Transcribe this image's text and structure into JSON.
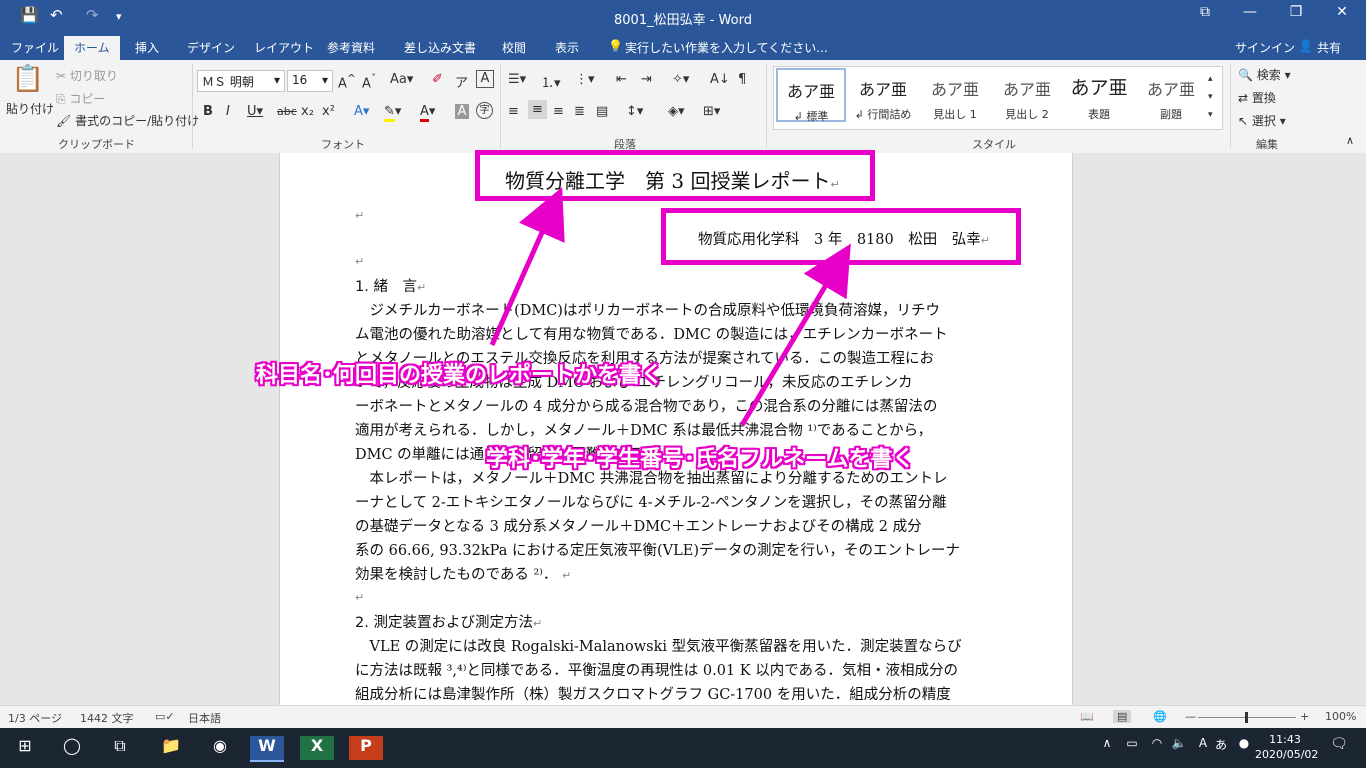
{
  "app": {
    "title": "8001_松田弘幸 - Word",
    "qat": {
      "save_glyph": "💾",
      "undo_glyph": "↶",
      "redo_glyph": "↷",
      "customize_glyph": "▾"
    },
    "window": {
      "restore_ribbon": "⧉",
      "minimize": "—",
      "maximize": "❐",
      "close": "✕"
    }
  },
  "tabs": [
    "ファイル",
    "ホーム",
    "挿入",
    "デザイン",
    "レイアウト",
    "参考資料",
    "差し込み文書",
    "校閲",
    "表示"
  ],
  "active_tab": "ホーム",
  "tell_me": "実行したい作業を入力してください...",
  "signin": "サインイン",
  "share": "共有",
  "ribbon": {
    "clipboard": {
      "paste": "貼り付け",
      "cut": "切り取り",
      "copy": "コピー",
      "format_painter": "書式のコピー/貼り付け",
      "label": "クリップボード"
    },
    "font": {
      "name": "ＭＳ 明朝",
      "size": "16",
      "label": "フォント"
    },
    "paragraph": {
      "label": "段落"
    },
    "styles": {
      "items": [
        {
          "sample": "あア亜",
          "name": "↲ 標準"
        },
        {
          "sample": "あア亜",
          "name": "↲ 行間詰め"
        },
        {
          "sample": "あア亜",
          "name": "見出し 1"
        },
        {
          "sample": "あア亜",
          "name": "見出し 2"
        },
        {
          "sample": "あア亜",
          "name": "表題"
        },
        {
          "sample": "あア亜",
          "name": "副題"
        }
      ],
      "label": "スタイル"
    },
    "editing": {
      "find": "検索",
      "replace": "置換",
      "select": "選択",
      "label": "編集"
    }
  },
  "document": {
    "title": "物質分離工学　第 3 回授業レポート",
    "author_line": "物質応用化学科　3 年　8180　松田　弘幸",
    "heading1": "1. 緒　言",
    "para1": [
      "　ジメチルカーボネート(DMC)はポリカーボネートの合成原料や低環境負荷溶媒，リチウ",
      "ム電池の優れた助溶媒として有用な物質である．DMC の製造には，エチレンカーボネート",
      "とメタノールとのエステル交換反応を利用する方法が提案されている．この製造工程にお",
      "いて，反応後の生成物は主成 DMC および エチレングリコール，未反応のエチレンカ",
      "ーボネートとメタノールの 4 成分から成る混合物であり，この混合系の分離には蒸留法の",
      "適用が考えられる．しかし，メタノール＋DMC 系は最低共沸混合物 ¹⁾であることから，",
      "DMC の単離には通常の蒸留では困難である．"
    ],
    "para2": [
      "　本レポートは，メタノール＋DMC 共沸混合物を抽出蒸留により分離するためのエントレ",
      "ーナとして 2-エトキシエタノールならびに 4-メチル-2-ペンタノンを選択し，その蒸留分離",
      "の基礎データとなる 3 成分系メタノール＋DMC＋エントレーナおよびその構成 2 成分",
      "系の 66.66, 93.32kPa における定圧気液平衡(VLE)データの測定を行い，そのエントレーナ",
      "効果を検討したものである ²⁾． "
    ],
    "heading2": "2. 測定装置および測定方法",
    "para3": [
      "　VLE の測定には改良 Rogalski-Malanowski 型気液平衡蒸留器を用いた．測定装置ならび",
      "に方法は既報 ³,⁴⁾と同様である．平衡温度の再現性は 0.01 K 以内である．気相・液相成分の",
      "組成分析には島津製作所（株）製ガスクロマトグラフ GC-1700 を用いた．組成分析の精度"
    ],
    "para_mark": "↵"
  },
  "annotations": {
    "callout_title": "科目名･何回目の授業のレポートかを書く",
    "callout_author": "学科･学年･学生番号･氏名フルネームを書く",
    "color": "#e600c8"
  },
  "status": {
    "page": "1/3 ページ",
    "words": "1442 文字",
    "language": "日本語",
    "zoom": "100%"
  },
  "taskbar": {
    "time": "11:43",
    "date": "2020/05/02",
    "ime": "あ"
  }
}
